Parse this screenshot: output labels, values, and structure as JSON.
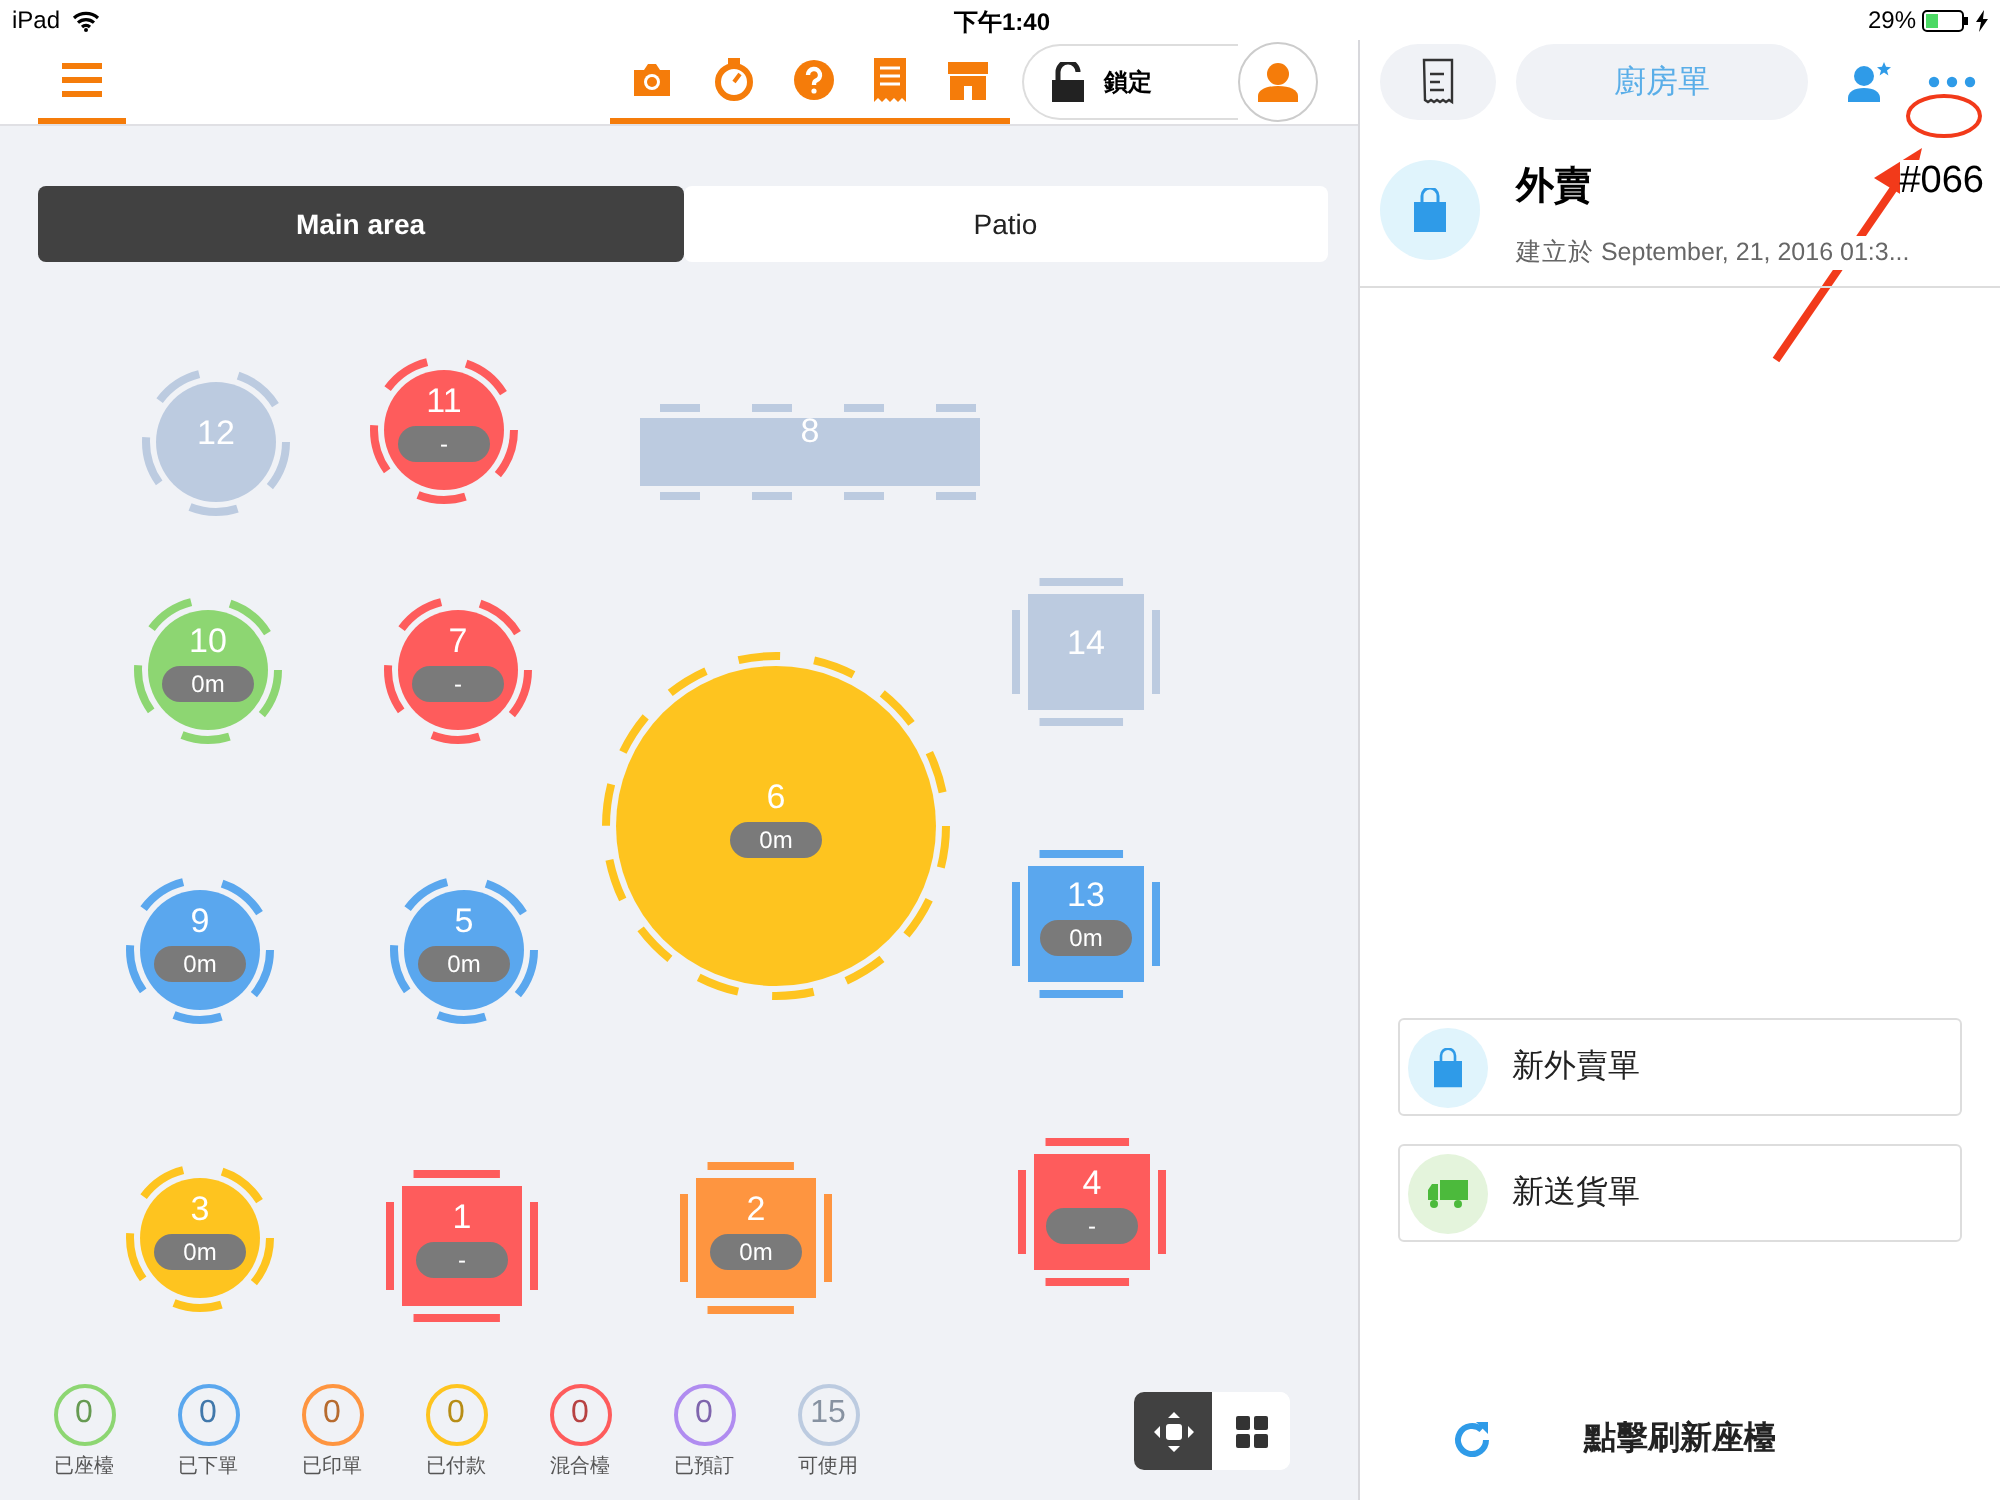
{
  "status_bar": {
    "device": "iPad",
    "time": "下午1:40",
    "battery": "29%"
  },
  "toolbar": {
    "lock_label": "鎖定"
  },
  "areas": [
    {
      "label": "Main area",
      "selected": true
    },
    {
      "label": "Patio",
      "selected": false
    }
  ],
  "tables": [
    {
      "number": "12",
      "kind": "round",
      "color": "#bccbe0"
    },
    {
      "number": "11",
      "kind": "round",
      "color": "#fe5c5c",
      "time": "-"
    },
    {
      "number": "8",
      "kind": "long",
      "color": "#bccbe0"
    },
    {
      "number": "10",
      "kind": "round",
      "color": "#8dd672",
      "time": "0m"
    },
    {
      "number": "7",
      "kind": "round",
      "color": "#fe5c5c",
      "time": "-"
    },
    {
      "number": "14",
      "kind": "square",
      "color": "#bccbe0"
    },
    {
      "number": "6",
      "kind": "round",
      "color": "#fec41f",
      "time": "0m"
    },
    {
      "number": "9",
      "kind": "round",
      "color": "#5aa7ee",
      "time": "0m"
    },
    {
      "number": "5",
      "kind": "round",
      "color": "#5aa7ee",
      "time": "0m"
    },
    {
      "number": "13",
      "kind": "square",
      "color": "#5aa7ee",
      "time": "0m"
    },
    {
      "number": "3",
      "kind": "round",
      "color": "#fec41f",
      "time": "0m"
    },
    {
      "number": "1",
      "kind": "square",
      "color": "#fe5c5c",
      "time": "-"
    },
    {
      "number": "2",
      "kind": "square",
      "color": "#fe9540",
      "time": "0m"
    },
    {
      "number": "4",
      "kind": "square",
      "color": "#fe5c5c",
      "time": "-"
    }
  ],
  "legend": [
    {
      "count": "0",
      "label": "已座檯",
      "color": "#8dd672"
    },
    {
      "count": "0",
      "label": "已下單",
      "color": "#5aa7ee"
    },
    {
      "count": "0",
      "label": "已印單",
      "color": "#fe9540"
    },
    {
      "count": "0",
      "label": "已付款",
      "color": "#fec41f"
    },
    {
      "count": "0",
      "label": "混合檯",
      "color": "#fe5c5c"
    },
    {
      "count": "0",
      "label": "已預訂",
      "color": "#b08cf0"
    },
    {
      "count": "15",
      "label": "可使用",
      "color": "#bccbe0"
    }
  ],
  "view_modes": [
    {
      "kind": "move",
      "selected": true
    },
    {
      "kind": "grid",
      "selected": false
    }
  ],
  "order_panel": {
    "kitchen_button": "廚房單",
    "order": {
      "title": "外賣",
      "number": "#066",
      "created": "建立於 September, 21, 2016 01:3..."
    },
    "actions": [
      {
        "kind": "takeaway",
        "label": "新外賣單"
      },
      {
        "kind": "delivery",
        "label": "新送貨單"
      }
    ],
    "refresh": "點擊刷新座檯"
  }
}
